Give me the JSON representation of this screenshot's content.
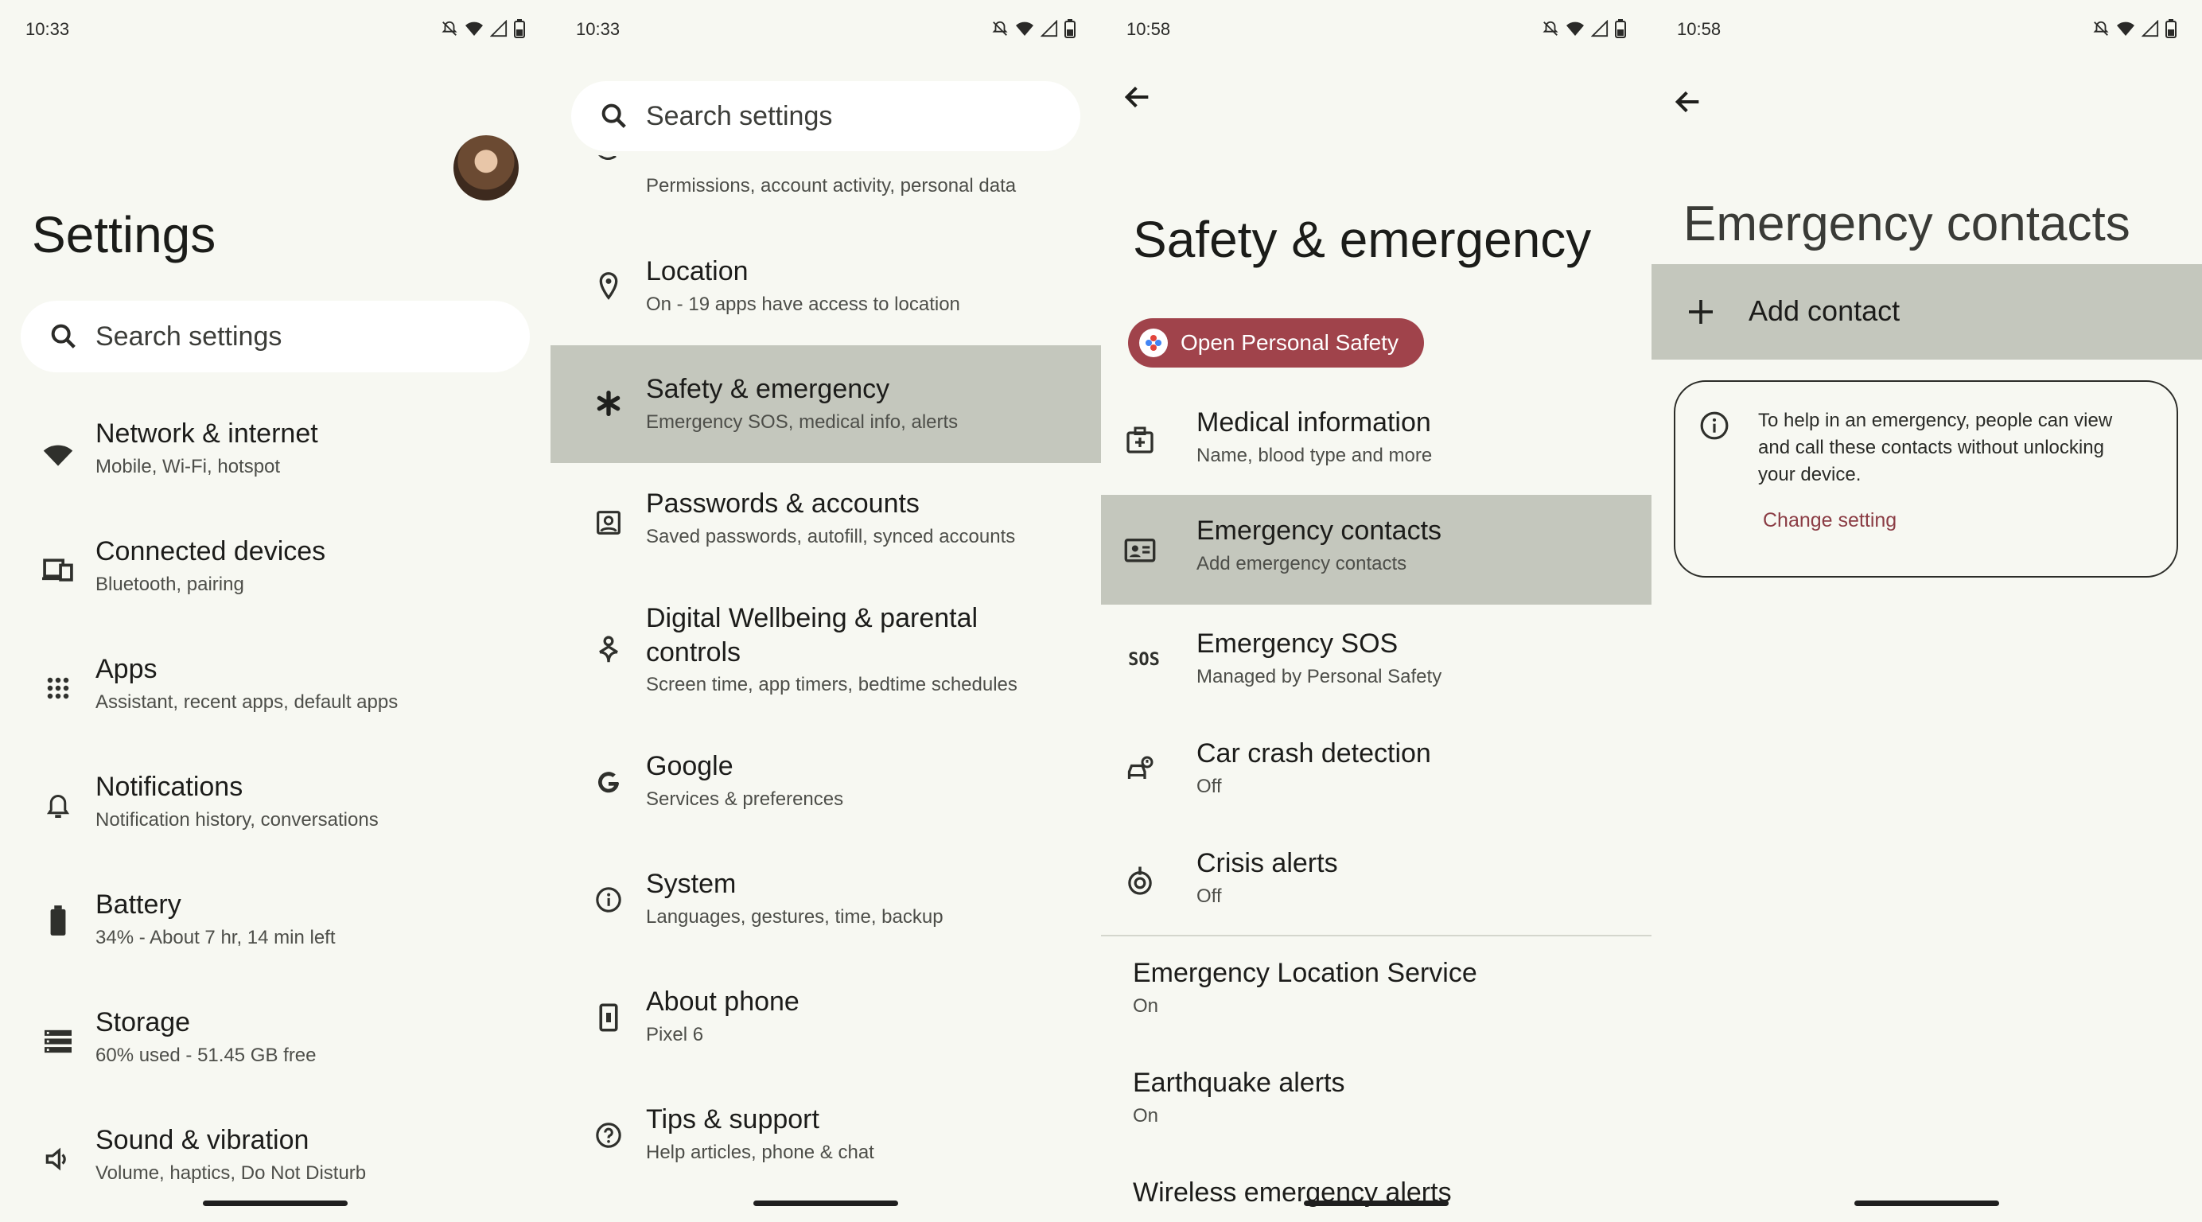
{
  "colors": {
    "background": "#f7f8f2",
    "highlight": "#c4c7bd",
    "accent_red": "#a0434b",
    "link": "#8b3d45"
  },
  "panels": [
    {
      "time": "10:33",
      "title": "Settings",
      "search_placeholder": "Search settings",
      "items": [
        {
          "icon": "wifi-icon",
          "title": "Network & internet",
          "subtitle": "Mobile, Wi-Fi, hotspot"
        },
        {
          "icon": "devices-icon",
          "title": "Connected devices",
          "subtitle": "Bluetooth, pairing"
        },
        {
          "icon": "apps-grid-icon",
          "title": "Apps",
          "subtitle": "Assistant, recent apps, default apps"
        },
        {
          "icon": "bell-icon",
          "title": "Notifications",
          "subtitle": "Notification history, conversations"
        },
        {
          "icon": "battery-icon",
          "title": "Battery",
          "subtitle": "34% - About 7 hr, 14 min left"
        },
        {
          "icon": "storage-icon",
          "title": "Storage",
          "subtitle": "60% used - 51.45 GB free"
        },
        {
          "icon": "speaker-icon",
          "title": "Sound & vibration",
          "subtitle": "Volume, haptics, Do Not Disturb"
        }
      ]
    },
    {
      "time": "10:33",
      "search_placeholder": "Search settings",
      "partial_subtitle": "Permissions, account activity, personal data",
      "items": [
        {
          "icon": "location-pin-icon",
          "title": "Location",
          "subtitle": "On - 19 apps have access to location"
        },
        {
          "icon": "asterisk-icon",
          "title": "Safety & emergency",
          "subtitle": "Emergency SOS, medical info, alerts"
        },
        {
          "icon": "account-box-icon",
          "title": "Passwords & accounts",
          "subtitle": "Saved passwords, autofill, synced accounts"
        },
        {
          "icon": "wellbeing-icon",
          "title": "Digital Wellbeing & parental controls",
          "subtitle": "Screen time, app timers, bedtime schedules"
        },
        {
          "icon": "google-g-icon",
          "title": "Google",
          "subtitle": "Services & preferences"
        },
        {
          "icon": "info-icon",
          "title": "System",
          "subtitle": "Languages, gestures, time, backup"
        },
        {
          "icon": "phone-icon",
          "title": "About phone",
          "subtitle": "Pixel 6"
        },
        {
          "icon": "help-icon",
          "title": "Tips & support",
          "subtitle": "Help articles, phone & chat"
        }
      ]
    },
    {
      "time": "10:58",
      "title": "Safety & emergency",
      "chip_label": "Open Personal Safety",
      "items": [
        {
          "icon": "medical-id-icon",
          "title": "Medical information",
          "subtitle": "Name, blood type and more"
        },
        {
          "icon": "contact-card-icon",
          "title": "Emergency contacts",
          "subtitle": "Add emergency contacts"
        },
        {
          "icon": "sos-icon",
          "icon_text": "SOS",
          "title": "Emergency SOS",
          "subtitle": "Managed by Personal Safety"
        },
        {
          "icon": "car-crash-icon",
          "title": "Car crash detection",
          "subtitle": "Off"
        },
        {
          "icon": "crisis-alert-icon",
          "title": "Crisis alerts",
          "subtitle": "Off"
        }
      ],
      "extra_items": [
        {
          "title": "Emergency Location Service",
          "subtitle": "On"
        },
        {
          "title": "Earthquake alerts",
          "subtitle": "On"
        },
        {
          "title": "Wireless emergency alerts"
        }
      ]
    },
    {
      "time": "10:58",
      "title": "Emergency contacts",
      "add_contact": "Add contact",
      "info_text": "To help in an emergency, people can view and call these contacts without unlocking your device.",
      "change_setting": "Change setting"
    }
  ]
}
